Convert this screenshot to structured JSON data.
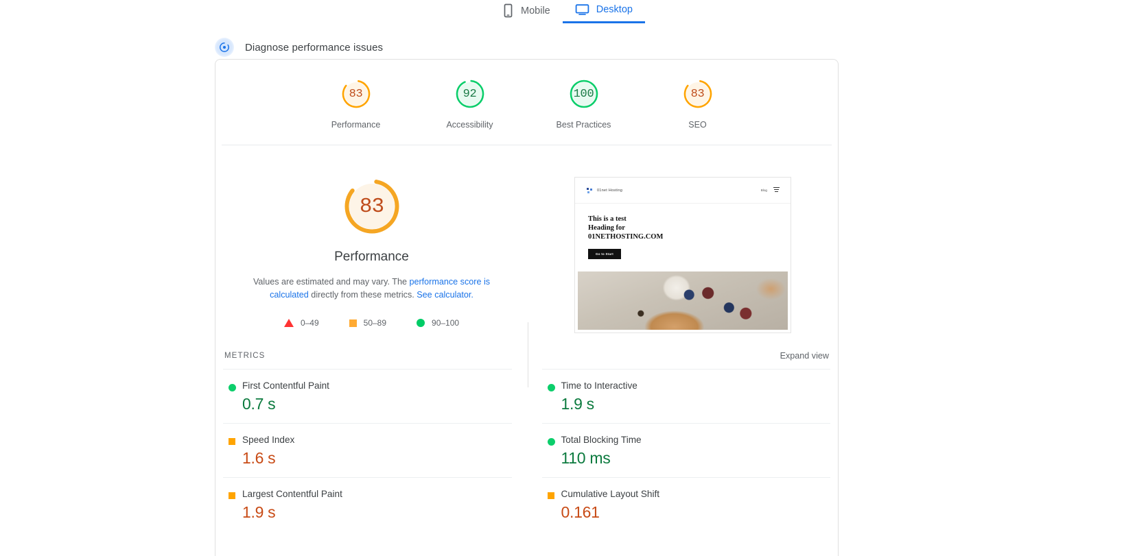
{
  "tabs": [
    {
      "label": "Mobile",
      "icon": "mobile-icon",
      "active": false
    },
    {
      "label": "Desktop",
      "icon": "desktop-icon",
      "active": true
    }
  ],
  "diagnose": {
    "label": "Diagnose performance issues",
    "icon": "performance-gauge-icon"
  },
  "category_scores": [
    {
      "label": "Performance",
      "value": "83",
      "score": 83,
      "color": "#ffa400",
      "text_color": "#bf4d1c",
      "fill": "#fff5e6"
    },
    {
      "label": "Accessibility",
      "value": "92",
      "score": 92,
      "color": "#0cce6b",
      "text_color": "#1b7a46",
      "fill": "#e8faf1"
    },
    {
      "label": "Best Practices",
      "value": "100",
      "score": 100,
      "color": "#0cce6b",
      "text_color": "#1b7a46",
      "fill": "#e8faf1"
    },
    {
      "label": "SEO",
      "value": "83",
      "score": 83,
      "color": "#ffa400",
      "text_color": "#bf4d1c",
      "fill": "#fff5e6"
    }
  ],
  "hero": {
    "score": "83",
    "score_percent": 83,
    "title": "Performance",
    "desc_part1": "Values are estimated and may vary. The ",
    "desc_link1": "performance score is calculated",
    "desc_part2": " directly from these metrics. ",
    "desc_link2": "See calculator.",
    "ring_color": "#f5a623",
    "ring_fill": "#fdf4e7",
    "score_color": "#bf4d1c"
  },
  "legend": [
    {
      "shape": "triangle",
      "label": "0–49",
      "color": "#ff3333"
    },
    {
      "shape": "square",
      "label": "50–89",
      "color": "#ffaa33"
    },
    {
      "shape": "circle",
      "label": "90–100",
      "color": "#00cc66"
    }
  ],
  "thumbnail": {
    "logo_text": "01net Hosting",
    "nav_link": "Blog",
    "heading": "This is a  test Heading for 01NETHOSTING.COM",
    "button": "Go to Start",
    "photo_alt": "croissant-with-berries-photo"
  },
  "metrics_section": {
    "label": "METRICS",
    "expand_label": "Expand view"
  },
  "metrics": {
    "left": [
      {
        "name": "First Contentful Paint",
        "value": "0.7 s",
        "mark": "circle",
        "mark_color": "#0cce6b",
        "value_color": "#0b7a3e"
      },
      {
        "name": "Speed Index",
        "value": "1.6 s",
        "mark": "square",
        "mark_color": "#ffa400",
        "value_color": "#c84b16"
      },
      {
        "name": "Largest Contentful Paint",
        "value": "1.9 s",
        "mark": "square",
        "mark_color": "#ffa400",
        "value_color": "#c84b16"
      }
    ],
    "right": [
      {
        "name": "Time to Interactive",
        "value": "1.9 s",
        "mark": "circle",
        "mark_color": "#0cce6b",
        "value_color": "#0b7a3e"
      },
      {
        "name": "Total Blocking Time",
        "value": "110 ms",
        "mark": "circle",
        "mark_color": "#0cce6b",
        "value_color": "#0b7a3e"
      },
      {
        "name": "Cumulative Layout Shift",
        "value": "0.161",
        "mark": "square",
        "mark_color": "#ffa400",
        "value_color": "#c84b16"
      }
    ]
  }
}
